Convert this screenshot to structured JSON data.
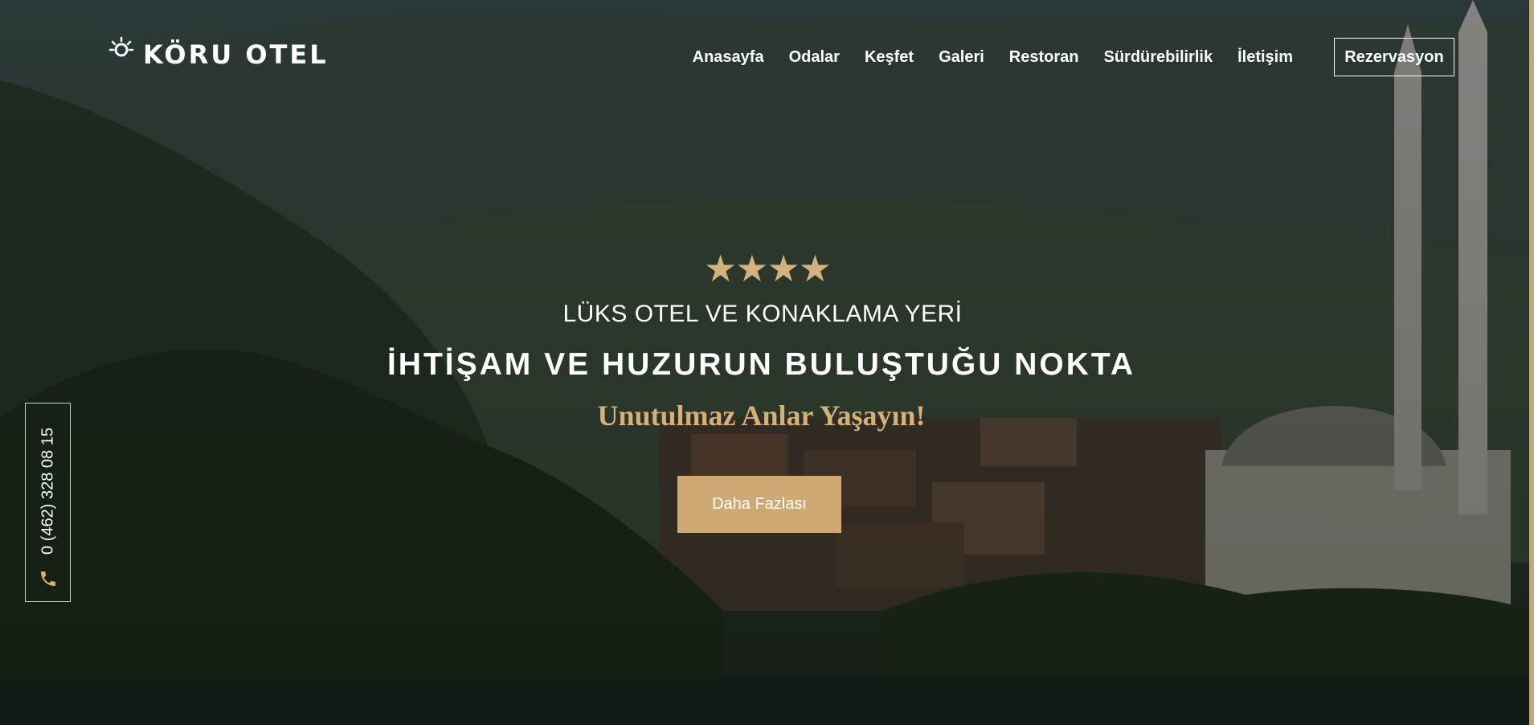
{
  "brand": {
    "name": "KÖRU OTEL"
  },
  "nav": {
    "items": [
      "Anasayfa",
      "Odalar",
      "Keşfet",
      "Galeri",
      "Restoran",
      "Sürdürebilirlik",
      "İletişim"
    ],
    "reservation_label": "Rezervasyon"
  },
  "hero": {
    "stars": "★★★★",
    "rating": 4,
    "subtitle": "LÜKS OTEL VE KONAKLAMA YERİ",
    "headline": "İHTİŞAM VE HUZURUN BULUŞTUĞU NOKTA",
    "tagline": "Unutulmaz Anlar Yaşayın!",
    "cta_label": "Daha Fazlası"
  },
  "contact": {
    "phone": "0 (462) 328 08 15",
    "icon": "phone-icon"
  },
  "colors": {
    "accent": "#d4b07a",
    "button": "#cfa974",
    "overlay": "#1e2a2a"
  }
}
